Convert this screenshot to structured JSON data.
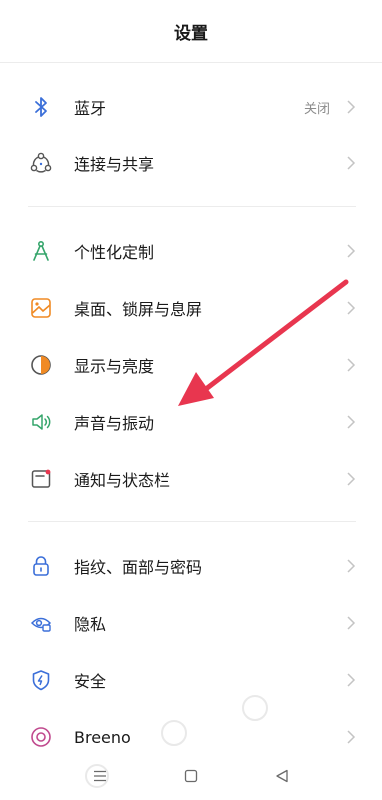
{
  "header": {
    "title": "设置"
  },
  "groups": [
    {
      "items": [
        {
          "label": "蓝牙",
          "value": "关闭",
          "icon": "bluetooth-icon"
        },
        {
          "label": "连接与共享",
          "icon": "share-connect-icon"
        }
      ]
    },
    {
      "items": [
        {
          "label": "个性化定制",
          "icon": "compass-drawing-icon"
        },
        {
          "label": "桌面、锁屏与息屏",
          "icon": "wallpaper-icon"
        },
        {
          "label": "显示与亮度",
          "icon": "brightness-icon"
        },
        {
          "label": "声音与振动",
          "icon": "speaker-icon"
        },
        {
          "label": "通知与状态栏",
          "icon": "notification-icon"
        }
      ]
    },
    {
      "items": [
        {
          "label": "指纹、面部与密码",
          "icon": "lock-icon"
        },
        {
          "label": "隐私",
          "icon": "privacy-eye-icon"
        },
        {
          "label": "安全",
          "icon": "shield-icon"
        },
        {
          "label": "Breeno",
          "icon": "breeno-icon"
        }
      ]
    }
  ],
  "annotation": {
    "type": "red-arrow",
    "color": "#e8364f",
    "target": "声音与振动"
  },
  "navbar": {
    "buttons": [
      "menu-icon",
      "home-square-icon",
      "back-triangle-icon"
    ]
  },
  "colors": {
    "accent_blue": "#3b6fd9",
    "accent_orange": "#f08a24",
    "accent_green": "#35a56b"
  }
}
